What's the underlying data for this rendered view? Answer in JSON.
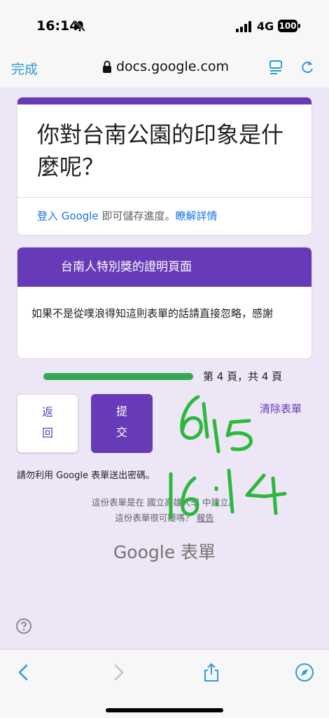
{
  "status": {
    "time": "16:14",
    "network": "4G",
    "battery": "100"
  },
  "browser": {
    "done_label": "完成",
    "url": "docs.google.com"
  },
  "form": {
    "title": "你對台南公園的印象是什麼呢？",
    "signin_link": "登入 Google",
    "signin_text": " 即可儲存進度。",
    "learn_more": "瞭解詳情",
    "section_title": "台南人特別獎的證明頁面",
    "section_desc": "如果不是從噗浪得知這則表單的話請直接忽略，感謝",
    "progress_text": "第 4 頁，共 4 頁",
    "progress_fraction": 1.0,
    "back_label_1": "返",
    "back_label_2": "回",
    "submit_label_1": "提",
    "submit_label_2": "交",
    "clear_label": "清除表單",
    "password_warning": "請勿利用 Google 表單送出密碼。",
    "footer_created": "這份表單是在 國立高雄大學 中建立。",
    "footer_suspicious": "這份表單很可疑嗎？",
    "footer_report": "報告",
    "logo_text": "Google 表單"
  },
  "handwriting": {
    "line1": "6/15",
    "line2": "16:14",
    "color": "#2db83d"
  },
  "colors": {
    "accent": "#673ab7",
    "progress": "#34a853",
    "link": "#1a73e8",
    "browser_blue": "#2e9bd6"
  }
}
